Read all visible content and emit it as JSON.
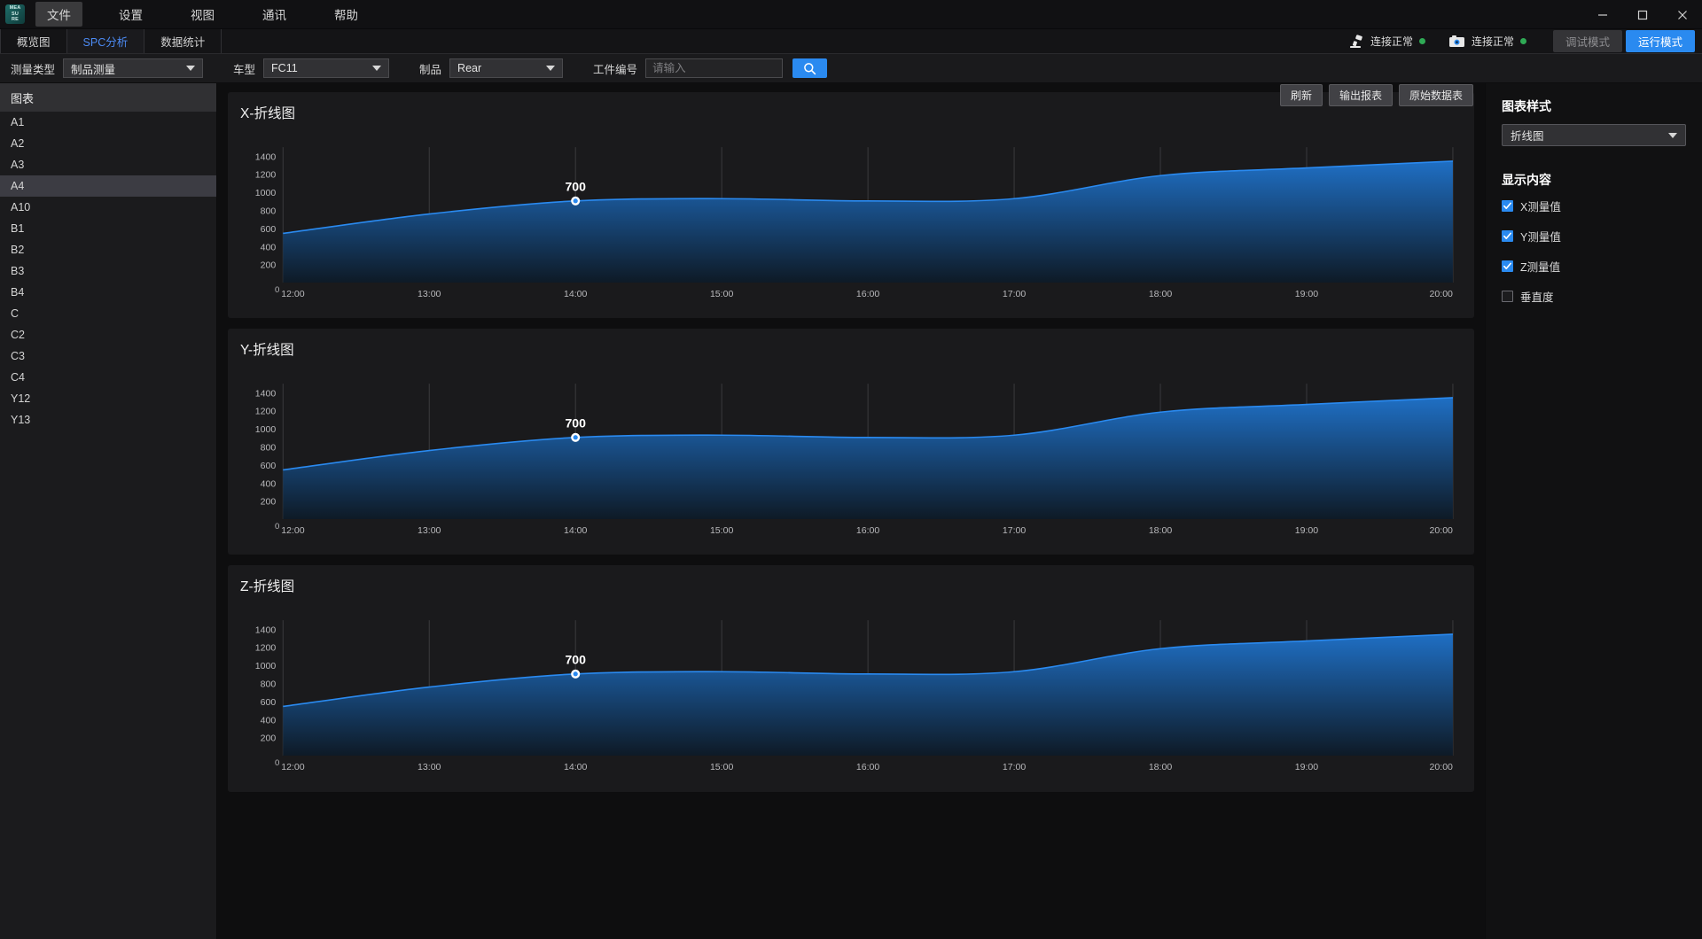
{
  "titlebar": {
    "logo_icon": "measure-logo-icon",
    "menu": [
      {
        "label": "文件",
        "active": true
      },
      {
        "label": "设置",
        "active": false
      },
      {
        "label": "视图",
        "active": false
      },
      {
        "label": "通讯",
        "active": false
      },
      {
        "label": "帮助",
        "active": false
      }
    ],
    "window_controls": {
      "minimize": "minimize-icon",
      "maximize": "maximize-icon",
      "close": "close-icon"
    }
  },
  "tabbar": {
    "tabs": [
      {
        "label": "概览图",
        "active": false
      },
      {
        "label": "SPC分析",
        "active": true
      },
      {
        "label": "数据统计",
        "active": false
      }
    ],
    "status": [
      {
        "icon": "scanner-icon",
        "label": "连接正常",
        "color": "#2faa55"
      },
      {
        "icon": "camera-icon",
        "label": "连接正常",
        "color": "#2faa55"
      }
    ],
    "modes": [
      {
        "label": "调试模式",
        "active": false
      },
      {
        "label": "运行模式",
        "active": true
      }
    ]
  },
  "filterbar": {
    "measure_type": {
      "label": "测量类型",
      "value": "制品测量"
    },
    "car_model": {
      "label": "车型",
      "value": "FC11"
    },
    "product": {
      "label": "制品",
      "value": "Rear"
    },
    "workpiece": {
      "label": "工件编号",
      "value": "",
      "placeholder": "请输入"
    },
    "search_icon": "search-icon"
  },
  "toolbar": {
    "refresh_label": "刷新",
    "export_label": "输出报表",
    "rawdata_label": "原始数据表"
  },
  "sidebar": {
    "header": "图表",
    "items": [
      {
        "label": "A1",
        "selected": false
      },
      {
        "label": "A2",
        "selected": false
      },
      {
        "label": "A3",
        "selected": false
      },
      {
        "label": "A4",
        "selected": true
      },
      {
        "label": "A10",
        "selected": false
      },
      {
        "label": "B1",
        "selected": false
      },
      {
        "label": "B2",
        "selected": false
      },
      {
        "label": "B3",
        "selected": false
      },
      {
        "label": "B4",
        "selected": false
      },
      {
        "label": "C",
        "selected": false
      },
      {
        "label": "C2",
        "selected": false
      },
      {
        "label": "C3",
        "selected": false
      },
      {
        "label": "C4",
        "selected": false
      },
      {
        "label": "Y12",
        "selected": false
      },
      {
        "label": "Y13",
        "selected": false
      }
    ]
  },
  "rightpanel": {
    "style_title": "图表样式",
    "style_value": "折线图",
    "content_title": "显示内容",
    "checkboxes": [
      {
        "label": "X测量值",
        "checked": true
      },
      {
        "label": "Y测量值",
        "checked": true
      },
      {
        "label": "Z测量值",
        "checked": true
      },
      {
        "label": "垂直度",
        "checked": false
      }
    ],
    "accent_color": "#2a8af0"
  },
  "chart_data": [
    {
      "type": "area",
      "title": "X-折线图",
      "xlabel": "",
      "ylabel": "",
      "ylim": [
        0,
        1500
      ],
      "yticks": [
        200,
        400,
        600,
        800,
        1000,
        1200,
        1400
      ],
      "origin_label": "0",
      "grid": true,
      "x": [
        "12:00",
        "13:00",
        "14:00",
        "15:00",
        "16:00",
        "17:00",
        "18:00",
        "19:00",
        "20:00"
      ],
      "values": [
        545,
        760,
        905,
        930,
        905,
        930,
        1185,
        1270,
        1345
      ],
      "marker": {
        "x": "14:00",
        "value": 700,
        "label": "700"
      },
      "line_color": "#2a8af0",
      "fill_top": "#1f6fc4",
      "fill_bottom": "#0e1a26"
    },
    {
      "type": "area",
      "title": "Y-折线图",
      "xlabel": "",
      "ylabel": "",
      "ylim": [
        0,
        1500
      ],
      "yticks": [
        200,
        400,
        600,
        800,
        1000,
        1200,
        1400
      ],
      "origin_label": "0",
      "grid": true,
      "x": [
        "12:00",
        "13:00",
        "14:00",
        "15:00",
        "16:00",
        "17:00",
        "18:00",
        "19:00",
        "20:00"
      ],
      "values": [
        545,
        760,
        905,
        930,
        905,
        930,
        1185,
        1270,
        1345
      ],
      "marker": {
        "x": "14:00",
        "value": 700,
        "label": "700"
      },
      "line_color": "#2a8af0",
      "fill_top": "#1f6fc4",
      "fill_bottom": "#0e1a26"
    },
    {
      "type": "area",
      "title": "Z-折线图",
      "xlabel": "",
      "ylabel": "",
      "ylim": [
        0,
        1500
      ],
      "yticks": [
        200,
        400,
        600,
        800,
        1000,
        1200,
        1400
      ],
      "origin_label": "0",
      "grid": true,
      "x": [
        "12:00",
        "13:00",
        "14:00",
        "15:00",
        "16:00",
        "17:00",
        "18:00",
        "19:00",
        "20:00"
      ],
      "values": [
        545,
        760,
        905,
        930,
        905,
        930,
        1185,
        1270,
        1345
      ],
      "marker": {
        "x": "14:00",
        "value": 700,
        "label": "700"
      },
      "line_color": "#2a8af0",
      "fill_top": "#1f6fc4",
      "fill_bottom": "#0e1a26"
    }
  ]
}
